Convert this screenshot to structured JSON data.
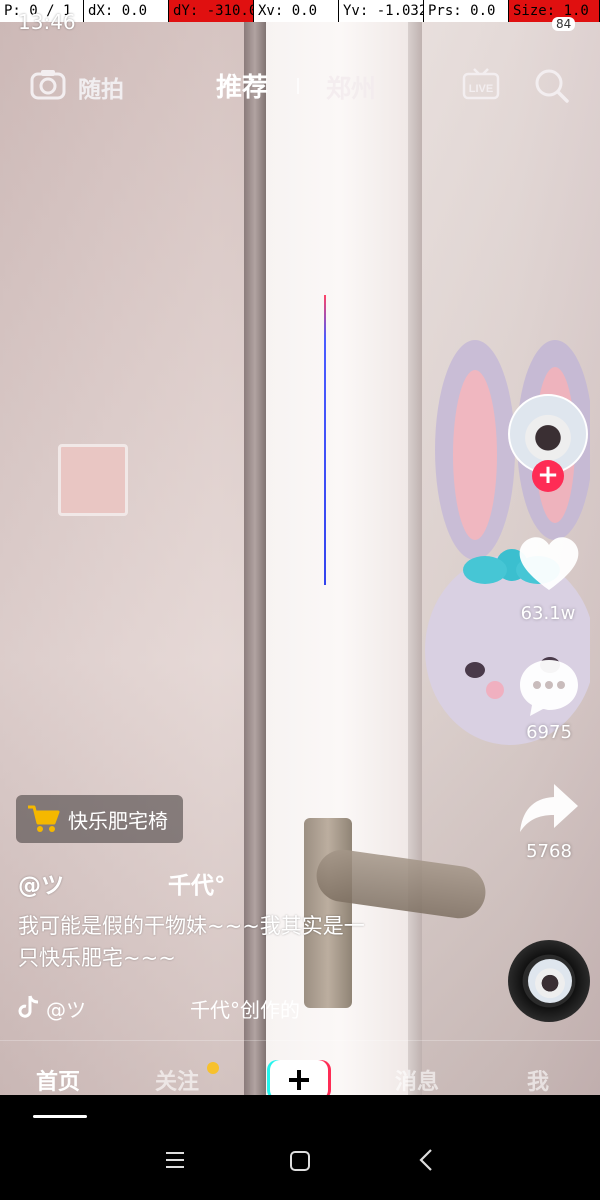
{
  "debug_bar": {
    "pointer": "P: 0 / 1",
    "dx": "dX: 0.0",
    "dy": "dY: -310.0",
    "xv": "Xv: 0.0",
    "yv": "Yv: -1.032",
    "prs": "Prs: 0.0",
    "size": "Size: 1.0"
  },
  "status_bar": {
    "time": "13:46",
    "battery": "84"
  },
  "top_nav": {
    "camera_label": "随拍",
    "tabs": [
      {
        "label": "推荐",
        "active": true
      },
      {
        "label": "郑州",
        "active": false
      }
    ],
    "live_icon": "live-icon",
    "search_icon": "search-icon"
  },
  "actions": {
    "like_count": "63.1w",
    "comment_count": "6975",
    "share_count": "5768"
  },
  "shop_tag": {
    "label": "快乐肥宅椅",
    "icon": "cart-icon"
  },
  "post": {
    "username_prefix": "@ツ",
    "username_suffix": "千代°",
    "caption_line1": "我可能是假的干物妹~~~我其实是一",
    "caption_line2": "只快乐肥宅~~~",
    "music_prefix": "@ツ",
    "music_suffix": "千代°创作的"
  },
  "bottom_tabs": {
    "home": "首页",
    "follow": "关注",
    "messages": "消息",
    "me": "我"
  },
  "colors": {
    "accent_red": "#fe2c55",
    "notify_yellow": "#f7c12d"
  }
}
